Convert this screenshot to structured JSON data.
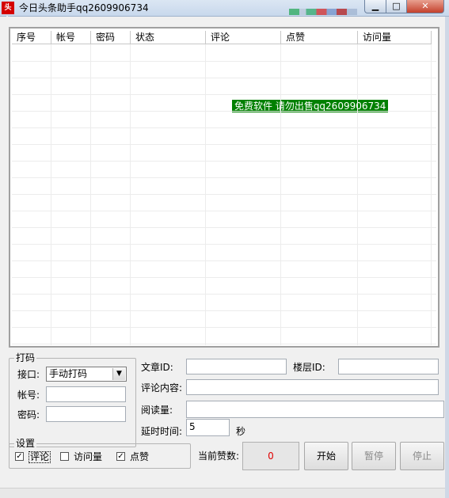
{
  "window": {
    "title": "今日头条助手qq2609906734",
    "icon_text": "头条"
  },
  "list": {
    "columns": [
      "序号",
      "帐号",
      "密码",
      "状态",
      "评论",
      "点赞",
      "访问量"
    ],
    "overlay_text": "免费软件 请勿出售qq2609906734"
  },
  "captcha_group": {
    "title": "打码",
    "interface_label": "接口:",
    "interface_value": "手动打码",
    "account_label": "帐号:",
    "account_value": "",
    "password_label": "密码:",
    "password_value": ""
  },
  "article": {
    "article_id_label": "文章ID:",
    "article_id_value": "",
    "floor_id_label": "楼层ID:",
    "floor_id_value": "",
    "comment_label": "评论内容:",
    "comment_value": "",
    "read_label": "阅读量:",
    "read_value": "",
    "delay_label": "延时时间:",
    "delay_value": "5",
    "delay_unit": "秒"
  },
  "settings": {
    "title": "设置",
    "options": [
      {
        "label": "评论",
        "checked": true
      },
      {
        "label": "访问量",
        "checked": false
      },
      {
        "label": "点赞",
        "checked": true
      }
    ]
  },
  "counter": {
    "label": "当前赞数:",
    "value": "0"
  },
  "buttons": {
    "start": "开始",
    "pause": "暂停",
    "stop": "停止"
  },
  "colors": {
    "overlay_bg": "#008000",
    "counter_text": "#e00000",
    "close_button": "#c4402c"
  }
}
